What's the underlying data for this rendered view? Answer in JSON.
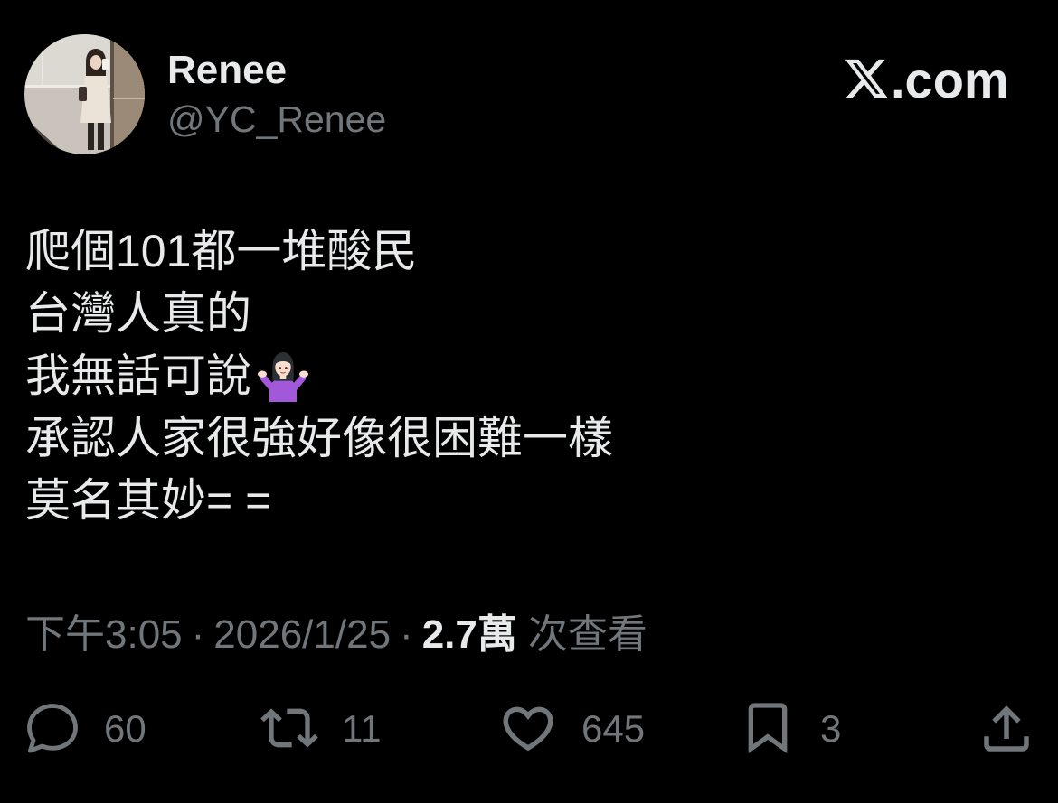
{
  "author": {
    "name": "Renee",
    "handle": "@YC_Renee"
  },
  "brand": {
    "logo": "X",
    "domain_suffix": ".com"
  },
  "tweet": {
    "lines": [
      {
        "text": "爬個101都一堆酸民"
      },
      {
        "text": "台灣人真的"
      },
      {
        "text": "我無話可說",
        "emoji": "woman-shrugging-icon"
      },
      {
        "text": "承認人家很強好像很困難一樣"
      },
      {
        "text": "莫名其妙= ="
      }
    ]
  },
  "meta": {
    "time": "下午3:05",
    "separator": "·",
    "date": "2026/1/25",
    "views_count": "2.7萬",
    "views_label": "次查看"
  },
  "actions": {
    "reply": {
      "icon": "reply-icon",
      "count": "60"
    },
    "repost": {
      "icon": "repost-icon",
      "count": "11"
    },
    "like": {
      "icon": "heart-icon",
      "count": "645"
    },
    "bookmark": {
      "icon": "bookmark-icon",
      "count": "3"
    },
    "share": {
      "icon": "share-icon"
    }
  },
  "colors": {
    "background": "#000000",
    "primary_text": "#e7e9ea",
    "secondary_text": "#71767b"
  }
}
